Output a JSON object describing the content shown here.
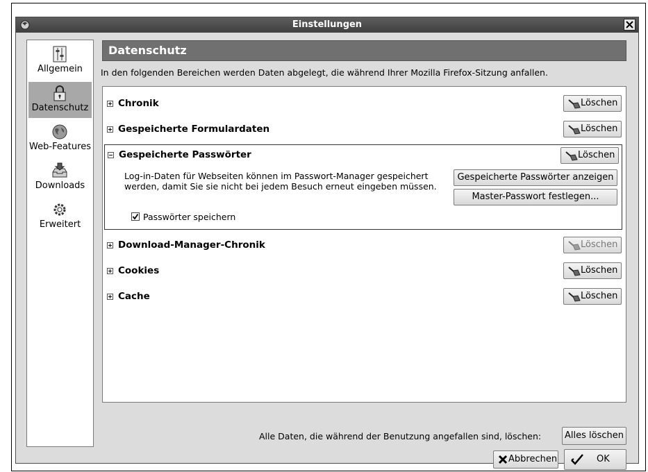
{
  "window": {
    "title": "Einstellungen"
  },
  "sidebar": {
    "items": [
      {
        "label": "Allgemein",
        "icon": "general-settings-icon"
      },
      {
        "label": "Datenschutz",
        "icon": "lock-icon",
        "selected": true
      },
      {
        "label": "Web-Features",
        "icon": "globe-icon"
      },
      {
        "label": "Downloads",
        "icon": "download-tray-icon"
      },
      {
        "label": "Erweitert",
        "icon": "gear-icon"
      }
    ]
  },
  "panel": {
    "title": "Datenschutz",
    "description": "In den folgenden Bereichen werden Daten abgelegt, die während Ihrer Mozilla Firefox-Sitzung anfallen."
  },
  "sections": [
    {
      "title": "Chronik",
      "clear_label": "Löschen",
      "expanded": false
    },
    {
      "title": "Gespeicherte Formulardaten",
      "clear_label": "Löschen",
      "expanded": false
    },
    {
      "title": "Gespeicherte Passwörter",
      "clear_label": "Löschen",
      "expanded": true,
      "text": "Log-in-Daten für Webseiten können im Passwort-Manager gespeichert werden, damit Sie sie nicht bei jedem Besuch erneut eingeben müssen.",
      "show_passwords_label": "Gespeicherte Passwörter anzeigen",
      "master_password_label": "Master-Passwort festlegen...",
      "save_passwords_label": "Passwörter speichern",
      "save_passwords_checked": true
    },
    {
      "title": "Download-Manager-Chronik",
      "clear_label": "Löschen",
      "expanded": false
    },
    {
      "title": "Cookies",
      "clear_label": "Löschen",
      "expanded": false
    },
    {
      "title": "Cache",
      "clear_label": "Löschen",
      "expanded": false
    }
  ],
  "footer": {
    "clear_all_text": "Alle Daten, die während der Benutzung angefallen sind, löschen:",
    "clear_all_label": "Alles löschen",
    "cancel_label": "Abbrechen",
    "ok_label": "OK"
  }
}
